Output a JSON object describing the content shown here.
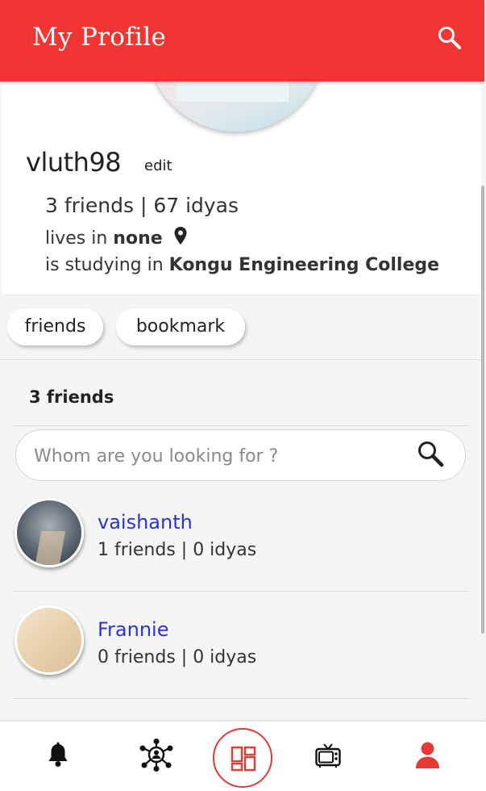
{
  "header": {
    "title": "My Profile",
    "search_icon": "search-icon",
    "background": "#f03534"
  },
  "profile": {
    "username": "vluth98",
    "edit_label": "edit",
    "stats": "3 friends | 67 idyas",
    "lives_prefix": "lives in",
    "lives_value": "none",
    "studying_prefix": "is studying in",
    "studying_value": "Kongu Engineering College"
  },
  "tabs": [
    {
      "label": "friends"
    },
    {
      "label": "bookmark"
    }
  ],
  "friends_section": {
    "heading": "3 friends",
    "search_placeholder": "Whom are you looking for ?"
  },
  "friends": [
    {
      "name": "vaishanth",
      "stats": "1 friends | 0 idyas"
    },
    {
      "name": "Frannie",
      "stats": "0 friends | 0 idyas"
    }
  ],
  "bottom_nav": {
    "items": [
      {
        "icon": "bell-icon"
      },
      {
        "icon": "network-icon"
      },
      {
        "icon": "dashboard-icon"
      },
      {
        "icon": "tv-icon"
      },
      {
        "icon": "user-icon"
      }
    ],
    "accent": "#e53935"
  },
  "colors": {
    "link": "#2a33d6",
    "accent": "#f03534"
  }
}
